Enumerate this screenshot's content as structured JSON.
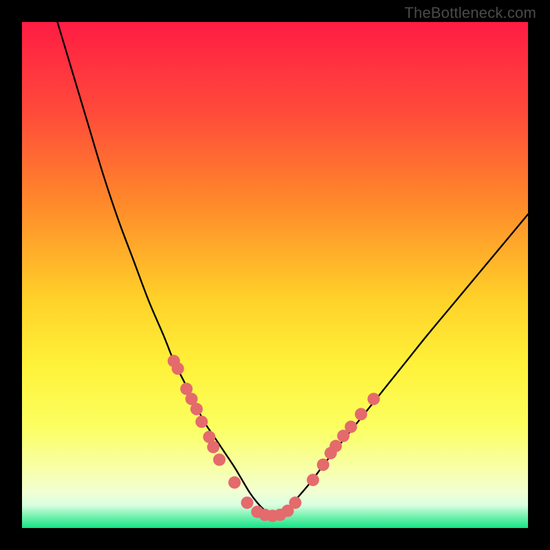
{
  "watermark": "TheBottleneck.com",
  "colors": {
    "top": "#ff1f47",
    "mid_upper": "#ff8a2a",
    "mid": "#ffe83a",
    "mid_lower": "#f8ff6a",
    "pale": "#f3ffb8",
    "green": "#19e98a",
    "curve": "#000000",
    "marker": "#e46a6c",
    "frame": "#000000"
  },
  "gradient_stops": [
    {
      "offset": 0,
      "color": "#ff1c44"
    },
    {
      "offset": 0.18,
      "color": "#ff4b3a"
    },
    {
      "offset": 0.36,
      "color": "#ff8a2a"
    },
    {
      "offset": 0.55,
      "color": "#ffd229"
    },
    {
      "offset": 0.68,
      "color": "#fff23a"
    },
    {
      "offset": 0.8,
      "color": "#fbff60"
    },
    {
      "offset": 0.88,
      "color": "#f8ffa6"
    },
    {
      "offset": 0.93,
      "color": "#f1ffd4"
    },
    {
      "offset": 0.955,
      "color": "#d8ffe0"
    },
    {
      "offset": 0.975,
      "color": "#7df2b3"
    },
    {
      "offset": 1.0,
      "color": "#14e586"
    }
  ],
  "chart_data": {
    "type": "line",
    "title": "",
    "xlabel": "",
    "ylabel": "",
    "x_range": [
      0,
      100
    ],
    "y_range": [
      0,
      100
    ],
    "series": [
      {
        "name": "bottleneck-curve",
        "x": [
          7,
          10,
          13,
          16,
          19,
          22,
          25,
          28,
          30,
          32,
          34,
          36,
          38,
          40,
          42,
          43.5,
          45,
          46.5,
          48,
          50,
          52,
          54,
          57,
          60,
          64,
          68,
          72,
          76,
          80,
          85,
          90,
          95,
          100
        ],
        "y": [
          100,
          90,
          80,
          70,
          61,
          53,
          45,
          38,
          33,
          29,
          25,
          21,
          18,
          15,
          12,
          9.5,
          7,
          5,
          3.5,
          2.5,
          3.5,
          5.5,
          9,
          13,
          18,
          23,
          28,
          33,
          38,
          44,
          50,
          56,
          62
        ]
      }
    ],
    "markers": {
      "name": "highlighted-points",
      "points": [
        {
          "x": 30.0,
          "y": 33.0
        },
        {
          "x": 30.8,
          "y": 31.5
        },
        {
          "x": 32.5,
          "y": 27.5
        },
        {
          "x": 33.5,
          "y": 25.5
        },
        {
          "x": 34.5,
          "y": 23.5
        },
        {
          "x": 35.5,
          "y": 21.0
        },
        {
          "x": 37.0,
          "y": 18.0
        },
        {
          "x": 37.8,
          "y": 16.0
        },
        {
          "x": 39.0,
          "y": 13.5
        },
        {
          "x": 42.0,
          "y": 9.0
        },
        {
          "x": 44.5,
          "y": 5.0
        },
        {
          "x": 46.5,
          "y": 3.2
        },
        {
          "x": 48.0,
          "y": 2.6
        },
        {
          "x": 49.5,
          "y": 2.4
        },
        {
          "x": 51.0,
          "y": 2.6
        },
        {
          "x": 52.5,
          "y": 3.4
        },
        {
          "x": 54.0,
          "y": 5.0
        },
        {
          "x": 57.5,
          "y": 9.5
        },
        {
          "x": 59.5,
          "y": 12.5
        },
        {
          "x": 61.0,
          "y": 14.8
        },
        {
          "x": 62.0,
          "y": 16.2
        },
        {
          "x": 63.5,
          "y": 18.2
        },
        {
          "x": 65.0,
          "y": 20.0
        },
        {
          "x": 67.0,
          "y": 22.5
        },
        {
          "x": 69.5,
          "y": 25.5
        }
      ],
      "radius": 9
    }
  }
}
